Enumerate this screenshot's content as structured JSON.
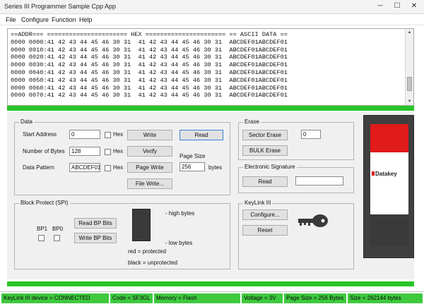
{
  "window": {
    "title": "Series III Programmer Sample Cpp App",
    "min_glyph": "─",
    "max_glyph": "☐",
    "close_glyph": "✕"
  },
  "menu": [
    "File",
    "Configure",
    "Function",
    "Help"
  ],
  "hex_view": {
    "header": "==ADDR=== ====================== HEX ====================== == ASCII DATA ==",
    "rows": [
      "0000 0000:41 42 43 44 45 46 30 31  41 42 43 44 45 46 30 31  ABCDEF01ABCDEF01",
      "0000 0010:41 42 43 44 45 46 30 31  41 42 43 44 45 46 30 31  ABCDEF01ABCDEF01",
      "0000 0020:41 42 43 44 45 46 30 31  41 42 43 44 45 46 30 31  ABCDEF01ABCDEF01",
      "0000 0030:41 42 43 44 45 46 30 31  41 42 43 44 45 46 30 31  ABCDEF01ABCDEF01",
      "0000 0040:41 42 43 44 45 46 30 31  41 42 43 44 45 46 30 31  ABCDEF01ABCDEF01",
      "0000 0050:41 42 43 44 45 46 30 31  41 42 43 44 45 46 30 31  ABCDEF01ABCDEF01",
      "0000 0060:41 42 43 44 45 46 30 31  41 42 43 44 45 46 30 31  ABCDEF01ABCDEF01",
      "0000 0070:41 42 43 44 45 46 30 31  41 42 43 44 45 46 30 31  ABCDEF01ABCDEF01"
    ]
  },
  "data_panel": {
    "title": "Data",
    "start_address_label": "Start Address",
    "start_address_value": "0",
    "number_of_bytes_label": "Number of Bytes",
    "number_of_bytes_value": "128",
    "data_pattern_label": "Data Pattern",
    "data_pattern_value": "ABCDEF01",
    "hex_label": "Hex",
    "write_label": "Write",
    "verify_label": "Verify",
    "page_write_label": "Page Write",
    "file_write_label": "File Write...",
    "read_label": "Read",
    "page_size_label": "Page Size",
    "page_size_value": "256",
    "bytes_label": "bytes"
  },
  "erase_panel": {
    "title": "Erase",
    "sector_erase_label": "Sector Erase",
    "sector_value": "0",
    "bulk_erase_label": "BULK Erase"
  },
  "esig_panel": {
    "title": "Electronic Signature",
    "read_label": "Read",
    "value": ""
  },
  "block_protect": {
    "title": "Block Protect (SPI)",
    "bp1_label": "BP1",
    "bp0_label": "BP0",
    "read_bits_label": "Read BP Bits",
    "write_bits_label": "Write BP Bits",
    "high_bytes_label": "- high bytes",
    "low_bytes_label": "- low bytes",
    "red_note": "red = protected",
    "black_note": "black = unprotected"
  },
  "keylink": {
    "title": "KeyLink III",
    "configure_label": "Configure...",
    "reset_label": "Reset"
  },
  "product": {
    "brand": "Datakey"
  },
  "status": [
    "KeyLink III device = CONNECTED",
    "Code = SF3GL",
    "Memory = Flash",
    "Voltage = 3V",
    "Page Size = 256 Bytes",
    "Size = 262144 bytes"
  ],
  "colors": {
    "status_green": "#3ec93e",
    "progress_green": "#28c428",
    "brand_red": "#e11a1a"
  }
}
